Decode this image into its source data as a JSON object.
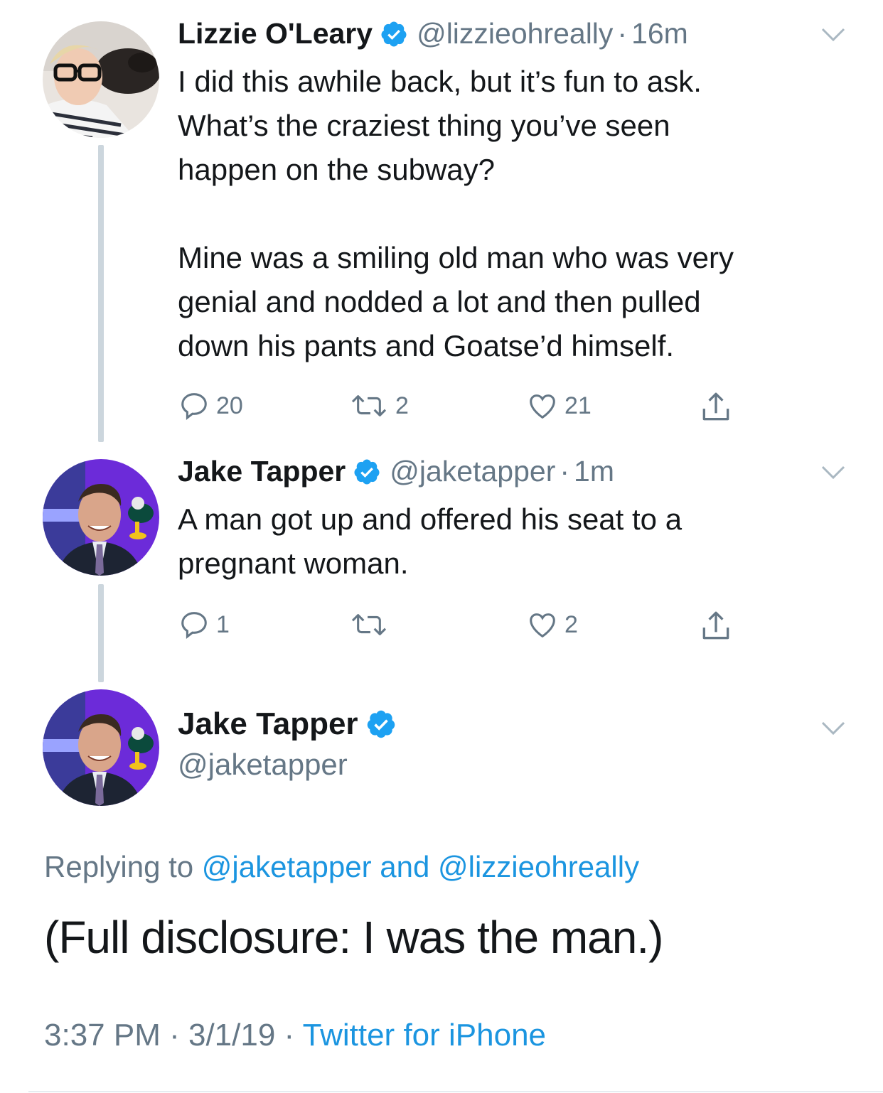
{
  "tweets": [
    {
      "name": "Lizzie O'Leary",
      "handle": "@lizzieohreally",
      "separator": "·",
      "time": "16m",
      "text": "I did this awhile back, but it’s fun to ask.\nWhat’s the craziest thing you’ve seen\nhappen on the subway?\n\nMine was a smiling old man who was very\ngenial and nodded a lot and then pulled\ndown his pants and Goatse’d himself.",
      "replies": "20",
      "retweets": "2",
      "likes": "21"
    },
    {
      "name": "Jake Tapper",
      "handle": "@jaketapper",
      "separator": "·",
      "time": "1m",
      "text": "A man got up and offered his seat to a\npregnant woman.",
      "replies": "1",
      "retweets": "",
      "likes": "2"
    }
  ],
  "focused": {
    "name": "Jake Tapper",
    "handle": "@jaketapper",
    "replying_prefix": "Replying to ",
    "reply_user1": "@jaketapper",
    "reply_and": " and ",
    "reply_user2": "@lizzieohreally",
    "text": "(Full disclosure: I was the man.)",
    "time": "3:37 PM",
    "sep1": " · ",
    "date": "3/1/19",
    "sep2": " · ",
    "source": "Twitter for iPhone"
  },
  "colors": {
    "verified": "#1da1f2",
    "link": "#1b95e0",
    "secondary_text": "#657786",
    "thread_line": "#ccd6dd"
  },
  "icons": [
    "verified-badge-icon",
    "chevron-down-icon",
    "reply-icon",
    "retweet-icon",
    "like-icon",
    "share-icon"
  ]
}
